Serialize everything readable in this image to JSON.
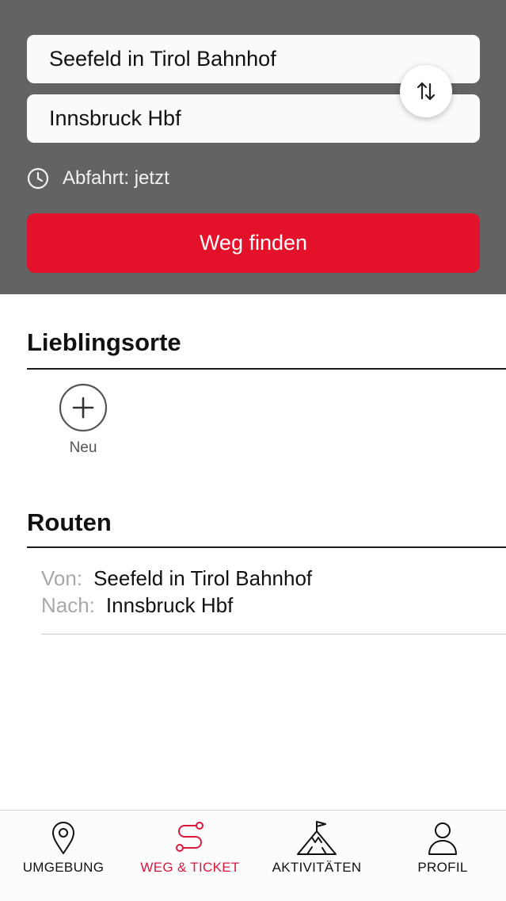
{
  "search": {
    "from_value": "Seefeld in Tirol Bahnhof",
    "to_value": "Innsbruck Hbf",
    "departure_label": "Abfahrt: jetzt",
    "find_button_label": "Weg finden",
    "swap_icon": "swap-vertical-icon"
  },
  "favorites": {
    "title": "Lieblingsorte",
    "add_label": "Neu"
  },
  "routes": {
    "title": "Routen",
    "items": [
      {
        "from_key": "Von:",
        "from_value": "Seefeld in Tirol Bahnhof",
        "to_key": "Nach:",
        "to_value": "Innsbruck Hbf"
      }
    ]
  },
  "tabbar": {
    "tabs": [
      {
        "label": "UMGEBUNG",
        "icon": "location-pin-icon",
        "active": false
      },
      {
        "label": "WEG & TICKET",
        "icon": "route-icon",
        "active": true
      },
      {
        "label": "AKTIVITÄTEN",
        "icon": "mountain-flag-icon",
        "active": false
      },
      {
        "label": "PROFIL",
        "icon": "person-icon",
        "active": false
      }
    ]
  },
  "colors": {
    "accent_red": "#e4112b",
    "active_tab": "#d8193b",
    "header_bg": "#636363"
  }
}
